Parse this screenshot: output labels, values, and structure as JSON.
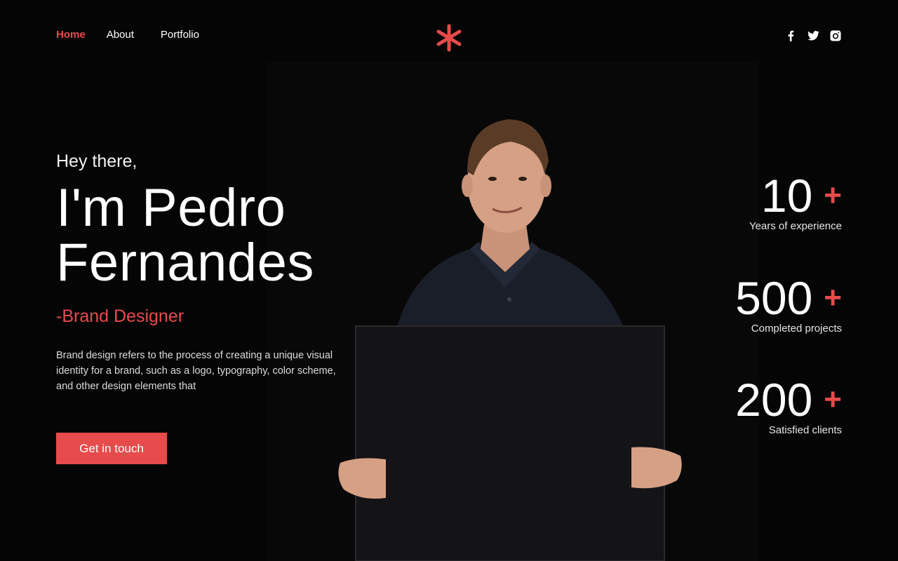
{
  "nav": {
    "items": [
      {
        "label": "Home",
        "active": true
      },
      {
        "label": "About",
        "active": false
      },
      {
        "label": "Portfolio",
        "active": false
      }
    ]
  },
  "logo": {
    "icon": "asterisk-icon",
    "color": "#e84b4b"
  },
  "social": [
    {
      "icon": "facebook-icon"
    },
    {
      "icon": "twitter-icon"
    },
    {
      "icon": "instagram-icon"
    }
  ],
  "hero": {
    "greeting": "Hey there,",
    "name_line1": "I'm Pedro",
    "name_line2": "Fernandes",
    "role": "-Brand Designer",
    "description": "Brand design refers to the process of creating a unique visual identity for a brand, such as a logo, typography, color scheme, and other design elements that",
    "cta_label": "Get in touch"
  },
  "stats": [
    {
      "value": "10",
      "suffix": "+",
      "label": "Years of experience"
    },
    {
      "value": "500",
      "suffix": "+",
      "label": "Completed projects"
    },
    {
      "value": "200",
      "suffix": "+",
      "label": "Satisfied clients"
    }
  ],
  "colors": {
    "accent": "#e84b4b",
    "background": "#050505",
    "text": "#ffffff"
  }
}
